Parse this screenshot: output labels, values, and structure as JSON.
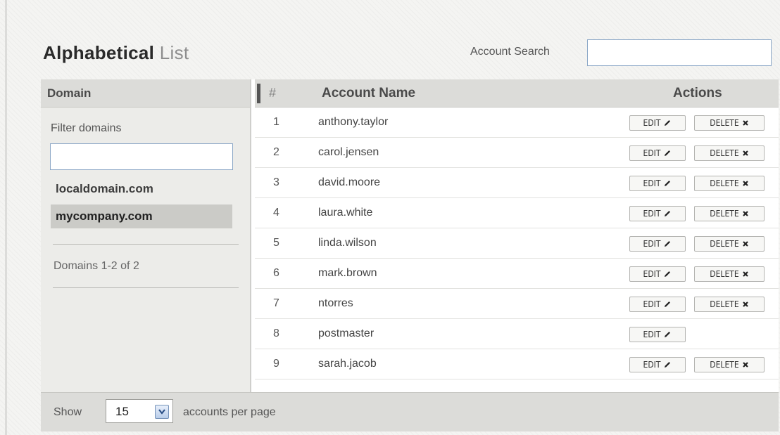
{
  "header": {
    "title_strong": "Alphabetical",
    "title_light": "List",
    "search_label": "Account Search",
    "search_value": ""
  },
  "domains": {
    "heading": "Domain",
    "filter_label": "Filter domains",
    "filter_value": "",
    "items": [
      {
        "label": "localdomain.com",
        "selected": false
      },
      {
        "label": "mycompany.com",
        "selected": true
      }
    ],
    "count_text": "Domains 1-2 of 2"
  },
  "accounts": {
    "columns": {
      "number": "#",
      "name": "Account Name",
      "actions": "Actions"
    },
    "edit_label": "EDIT",
    "delete_label": "DELETE",
    "rows": [
      {
        "num": "1",
        "name": "anthony.taylor",
        "can_delete": true
      },
      {
        "num": "2",
        "name": "carol.jensen",
        "can_delete": true
      },
      {
        "num": "3",
        "name": "david.moore",
        "can_delete": true
      },
      {
        "num": "4",
        "name": "laura.white",
        "can_delete": true
      },
      {
        "num": "5",
        "name": "linda.wilson",
        "can_delete": true
      },
      {
        "num": "6",
        "name": "mark.brown",
        "can_delete": true
      },
      {
        "num": "7",
        "name": "ntorres",
        "can_delete": true
      },
      {
        "num": "8",
        "name": "postmaster",
        "can_delete": false
      },
      {
        "num": "9",
        "name": "sarah.jacob",
        "can_delete": true
      }
    ]
  },
  "footer": {
    "show_label": "Show",
    "per_page_value": "15",
    "per_page_suffix": "accounts per page"
  },
  "icons": {
    "edit": "pencil-icon",
    "delete": "x-icon",
    "dropdown": "chevron-down-icon"
  }
}
